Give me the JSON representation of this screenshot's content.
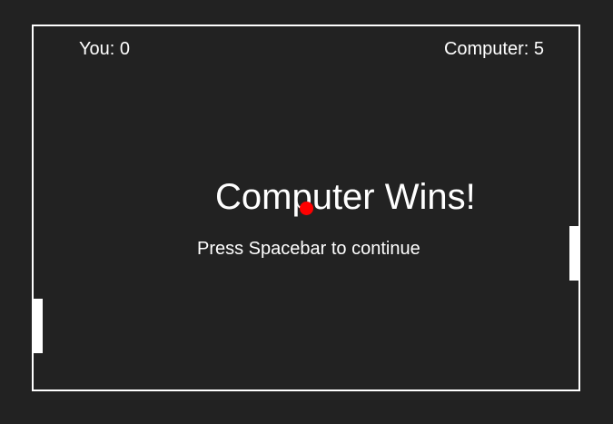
{
  "scoreboard": {
    "player_label": "You: 0",
    "computer_label": "Computer: 5",
    "player_score": 0,
    "computer_score": 5
  },
  "message": {
    "title": "Computer Wins!",
    "prompt": "Press Spacebar to continue"
  },
  "colors": {
    "background": "#222222",
    "foreground": "#ffffff",
    "ball": "#ff0000"
  }
}
